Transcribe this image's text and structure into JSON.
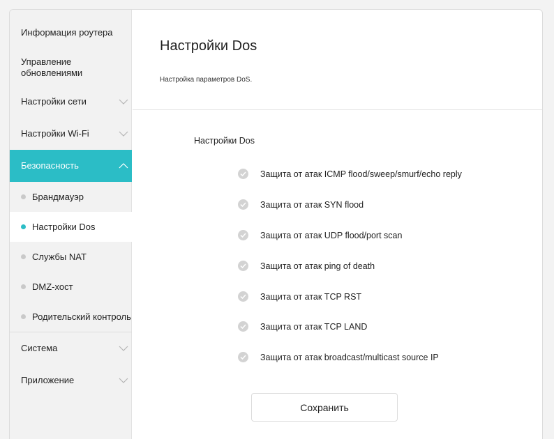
{
  "sidebar": {
    "router_info": "Информация роутера",
    "update_mgmt": "Управление обновлениями",
    "network": "Настройки сети",
    "wifi": "Настройки Wi-Fi",
    "security": "Безопасность",
    "security_items": {
      "firewall": "Брандмауэр",
      "dos": "Настройки Dos",
      "nat": "Службы NAT",
      "dmz": "DMZ-хост",
      "parental": "Родительский контроль"
    },
    "system": "Система",
    "application": "Приложение"
  },
  "main": {
    "title": "Настройки Dos",
    "description": "Настройка параметров DoS.",
    "section_title": "Настройки Dos",
    "options": [
      "Защита от атак ICMP flood/sweep/smurf/echo reply",
      "Защита от атак SYN flood",
      "Защита от атак UDP flood/port scan",
      "Защита от атак ping of death",
      "Защита от атак TCP RST",
      "Защита от атак TCP LAND",
      "Защита от атак broadcast/multicast source IP"
    ],
    "save_label": "Сохранить"
  },
  "colors": {
    "accent": "#2bbdc6",
    "check_bg": "#d3d3d3"
  },
  "icons": {
    "chevron": "chevron-down-icon",
    "chevron_active": "chevron-up-icon",
    "check": "check-circle-icon"
  }
}
